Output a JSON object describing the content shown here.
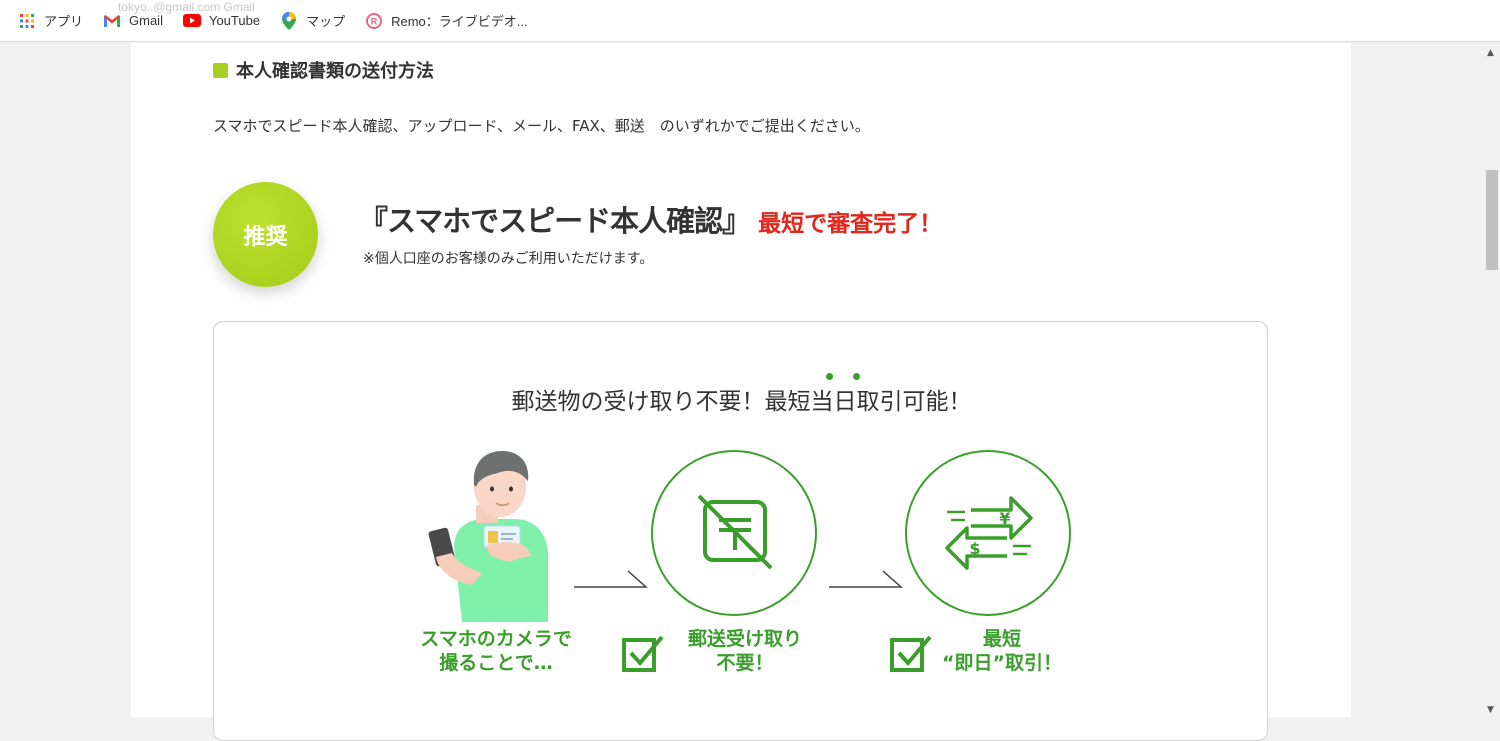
{
  "bookmarks": [
    {
      "label": "アプリ",
      "icon": "apps-grid-icon"
    },
    {
      "label": "Gmail",
      "icon": "gmail-icon"
    },
    {
      "label": "YouTube",
      "icon": "youtube-icon"
    },
    {
      "label": "マップ",
      "icon": "maps-pin-icon"
    },
    {
      "label": "Remo：ライブビデオ...",
      "icon": "remo-icon"
    }
  ],
  "ghost_text": "tokyo..@gmail.com Gmail",
  "section": {
    "title": "本人確認書類の送付方法",
    "intro": "スマホでスピード本人確認、アップロード、メール、FAX、郵送　のいずれかでご提出ください。"
  },
  "recommend": {
    "badge": "推奨",
    "headline": "『スマホでスピード本人確認』",
    "accent": "最短で審査完了！",
    "note": "※個人口座のお客様のみご利用いただけます。"
  },
  "card": {
    "title": "郵送物の受け取り不要！最短当日取引可能！",
    "steps": [
      {
        "caption_line1": "スマホのカメラで",
        "caption_line2": "撮ることで…",
        "icon": "smartphone-person-icon"
      },
      {
        "caption_line1": "郵送受け取り",
        "caption_line2": "不要！",
        "icon": "no-mail-icon"
      },
      {
        "caption_line1": "最短",
        "caption_line2": "“即日”取引！",
        "icon": "currency-exchange-icon"
      }
    ]
  },
  "colors": {
    "accent_green": "#3a9e2a",
    "badge_green": "#a7cf1f",
    "accent_red": "#e1261c"
  }
}
